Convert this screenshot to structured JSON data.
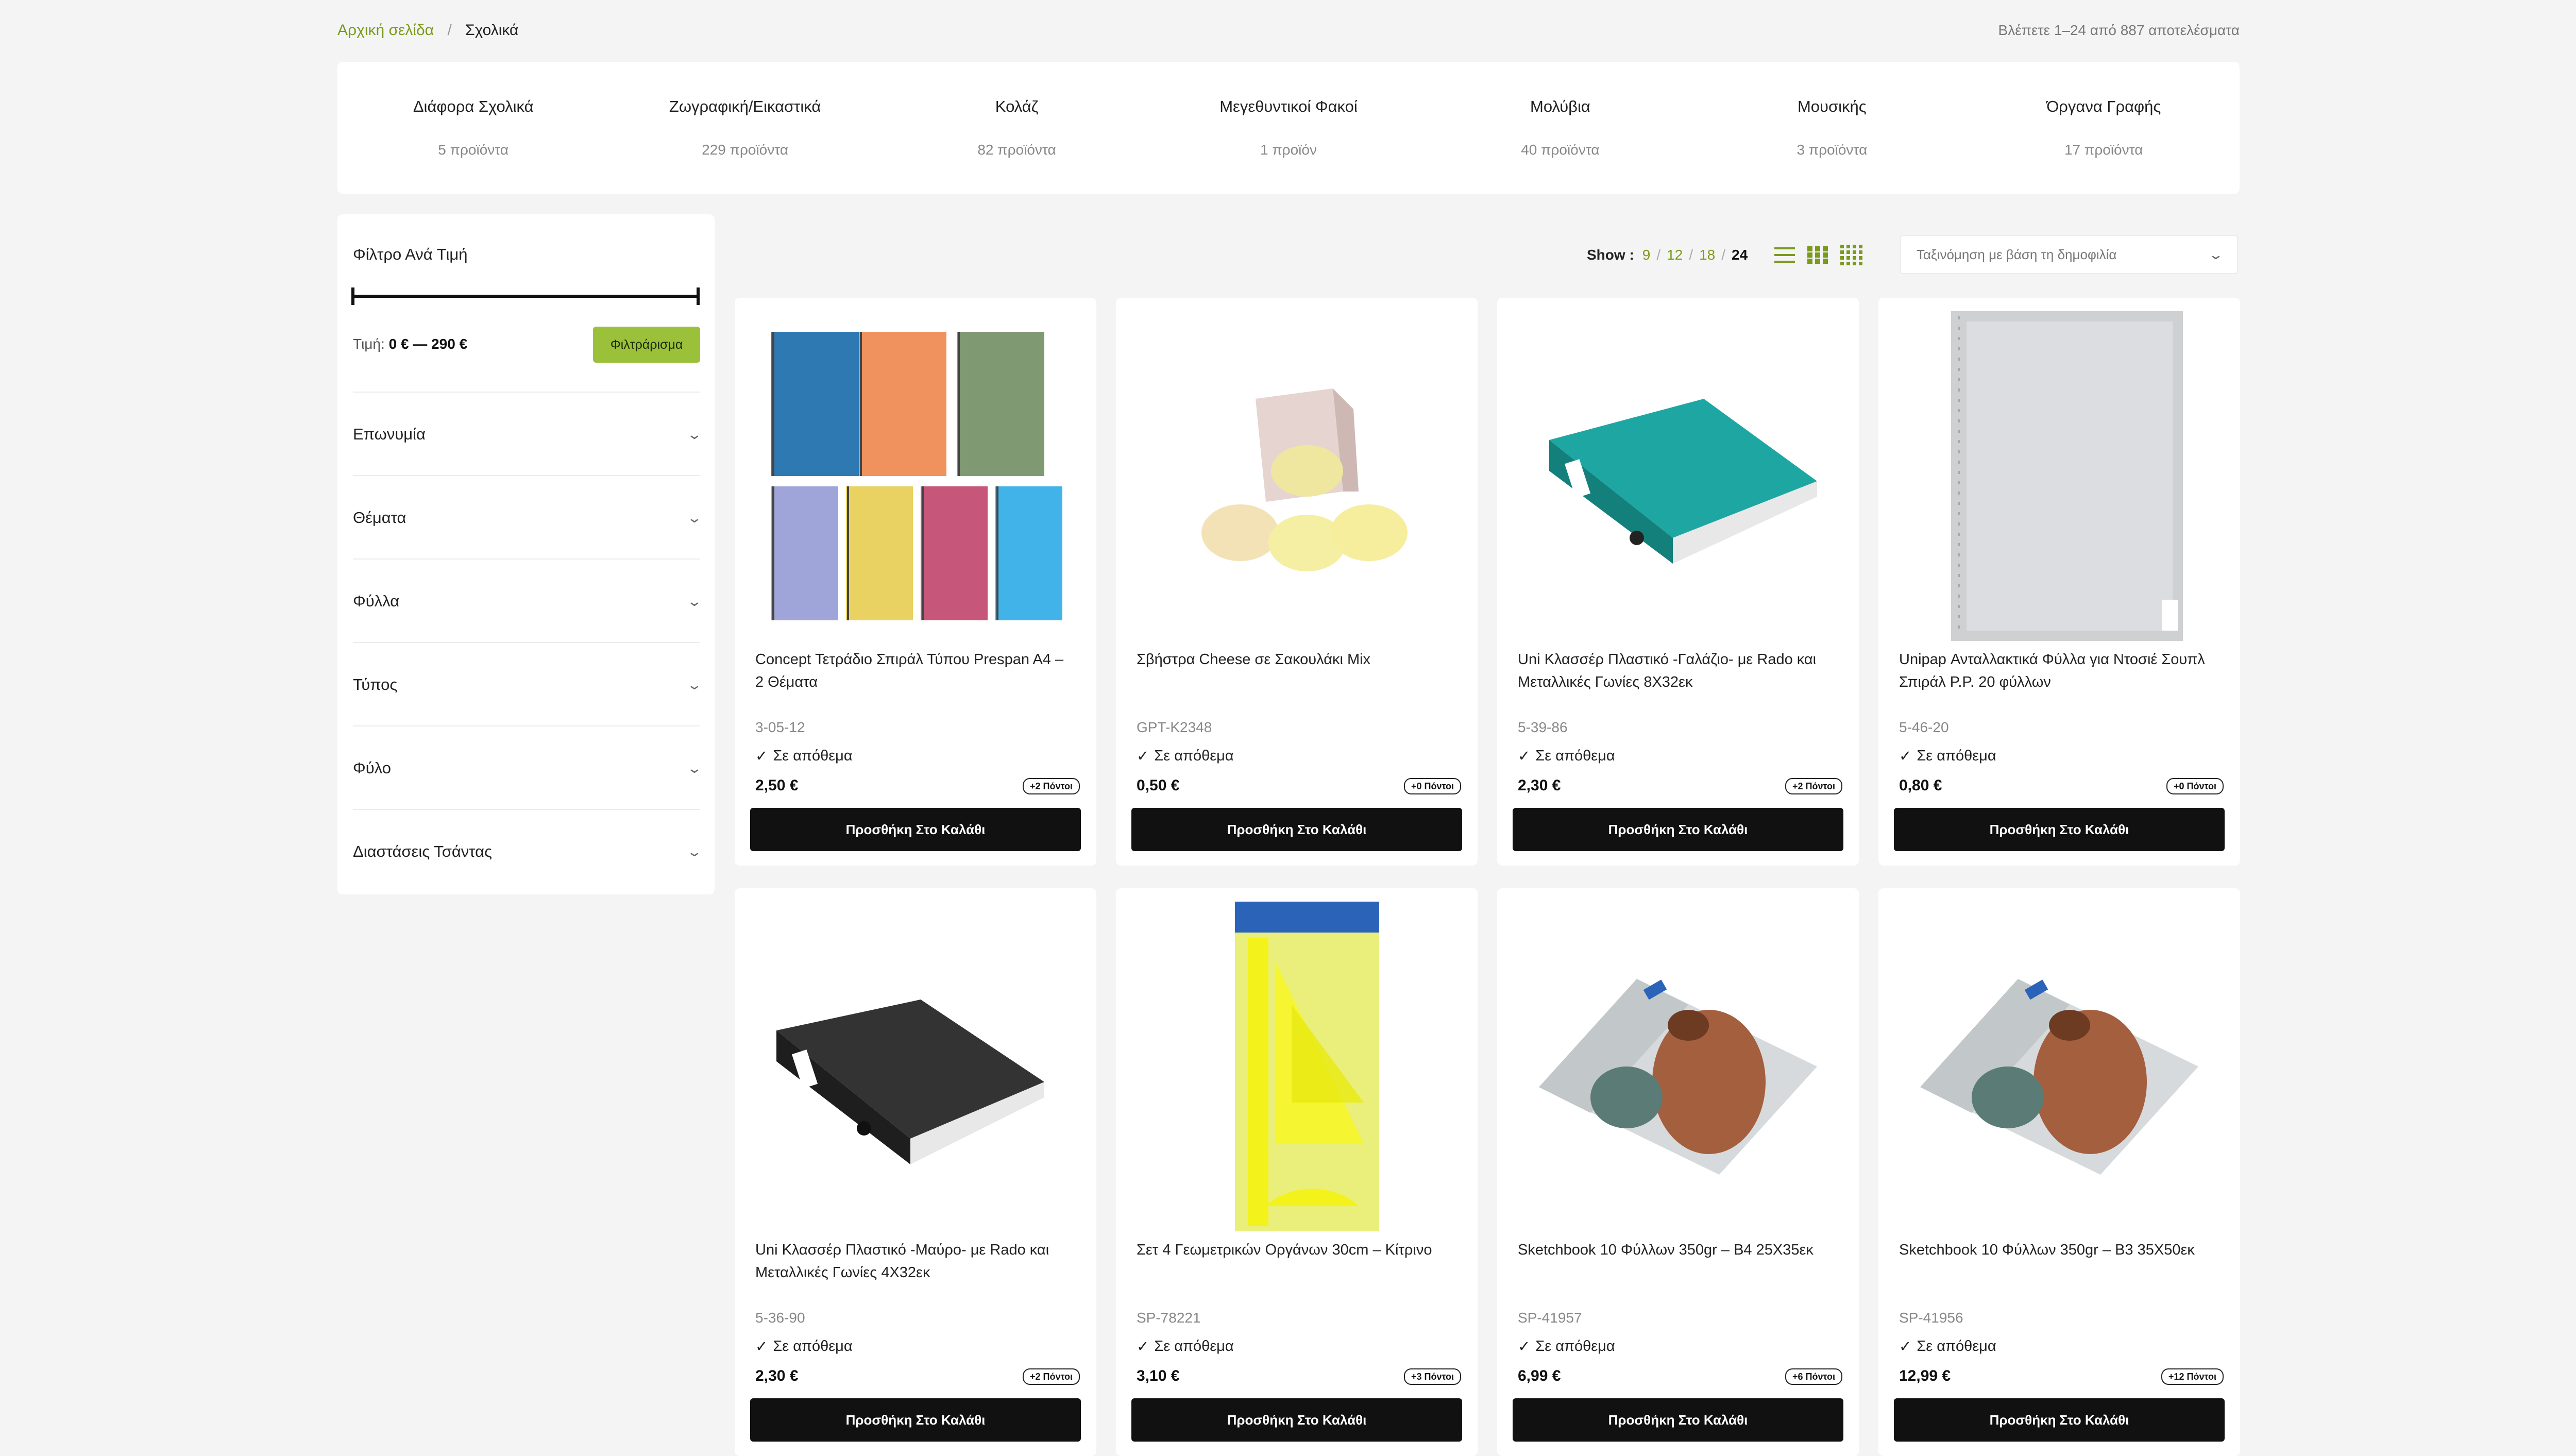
{
  "breadcrumb": {
    "home": "Αρχική σελίδα",
    "separator": "/",
    "current": "Σχολικά"
  },
  "result_count": "Βλέπετε 1–24 από 887 αποτελέσματα",
  "categories": [
    {
      "name": "Διάφορα Σχολικά",
      "count": "5 προϊόντα"
    },
    {
      "name": "Ζωγραφική/Εικαστικά",
      "count": "229 προϊόντα"
    },
    {
      "name": "Κολάζ",
      "count": "82 προϊόντα"
    },
    {
      "name": "Μεγεθυντικοί Φακοί",
      "count": "1 προϊόν"
    },
    {
      "name": "Μολύβια",
      "count": "40 προϊόντα"
    },
    {
      "name": "Μουσικής",
      "count": "3 προϊόντα"
    },
    {
      "name": "Όργανα Γραφής",
      "count": "17 προϊόντα"
    }
  ],
  "sidebar": {
    "price_filter_title": "Φίλτρο Ανά Τιμή",
    "price_label": "Τιμή:",
    "price_range": "0 € — 290 €",
    "filter_button": "Φιλτράρισμα",
    "accordions": [
      "Επωνυμία",
      "Θέματα",
      "Φύλλα",
      "Τύπος",
      "Φύλο",
      "Διαστάσεις Τσάντας"
    ]
  },
  "toolbar": {
    "show_label": "Show :",
    "show_options": [
      "9",
      "12",
      "18",
      "24"
    ],
    "show_active": "24",
    "sort_value": "Ταξινόμηση με βάση τη δημοφιλία",
    "icons": [
      "list-view-icon",
      "grid-3-icon",
      "grid-4-icon",
      "chevron-down-icon"
    ]
  },
  "products": [
    {
      "title": "Concept Τετράδιο Σπιράλ Τύπου Prespan A4 – 2 Θέματα",
      "sku": "3-05-12",
      "stock": "Σε απόθεμα",
      "price": "2,50 €",
      "points": "+2 Πόντοι",
      "button": "Προσθήκη Στο Καλάθι",
      "image": "notebooks"
    },
    {
      "title": "Σβήστρα Cheese σε Σακουλάκι Mix",
      "sku": "GPT-K2348",
      "stock": "Σε απόθεμα",
      "price": "0,50 €",
      "points": "+0 Πόντοι",
      "button": "Προσθήκη Στο Καλάθι",
      "image": "erasers"
    },
    {
      "title": "Uni Κλασσέρ Πλαστικό -Γαλάζιο- με Rado και Μεταλλικές Γωνίες 8Χ32εκ",
      "sku": "5-39-86",
      "stock": "Σε απόθεμα",
      "price": "2,30 €",
      "points": "+2 Πόντοι",
      "button": "Προσθήκη Στο Καλάθι",
      "image": "binder-teal"
    },
    {
      "title": "Unipap Ανταλλακτικά Φύλλα για Ντοσιέ Σουπλ Σπιράλ P.P. 20 φύλλων",
      "sku": "5-46-20",
      "stock": "Σε απόθεμα",
      "price": "0,80 €",
      "points": "+0 Πόντοι",
      "button": "Προσθήκη Στο Καλάθι",
      "image": "sheet-protectors"
    },
    {
      "title": "Uni Κλασσέρ Πλαστικό -Μαύρο- με Rado και Μεταλλικές Γωνίες 4Χ32εκ",
      "sku": "5-36-90",
      "stock": "Σε απόθεμα",
      "price": "2,30 €",
      "points": "+2 Πόντοι",
      "button": "Προσθήκη Στο Καλάθι",
      "image": "binder-black"
    },
    {
      "title": "Σετ 4 Γεωμετρικών Οργάνων 30cm – Κίτρινο",
      "sku": "SP-78221",
      "stock": "Σε απόθεμα",
      "price": "3,10 €",
      "points": "+3 Πόντοι",
      "button": "Προσθήκη Στο Καλάθι",
      "image": "geometry-set"
    },
    {
      "title": "Sketchbook 10 Φύλλων 350gr – B4 25Χ35εκ",
      "sku": "SP-41957",
      "stock": "Σε απόθεμα",
      "price": "6,99 €",
      "points": "+6 Πόντοι",
      "button": "Προσθήκη Στο Καλάθι",
      "image": "sketchbook"
    },
    {
      "title": "Sketchbook 10 Φύλλων 350gr – B3 35Χ50εκ",
      "sku": "SP-41956",
      "stock": "Σε απόθεμα",
      "price": "12,99 €",
      "points": "+12 Πόντοι",
      "button": "Προσθήκη Στο Καλάθι",
      "image": "sketchbook"
    }
  ],
  "colors": {
    "accent": "#7a9a1a",
    "filter_button": "#9bc13b",
    "cart_button": "#111111",
    "background": "#f4f4f5"
  }
}
